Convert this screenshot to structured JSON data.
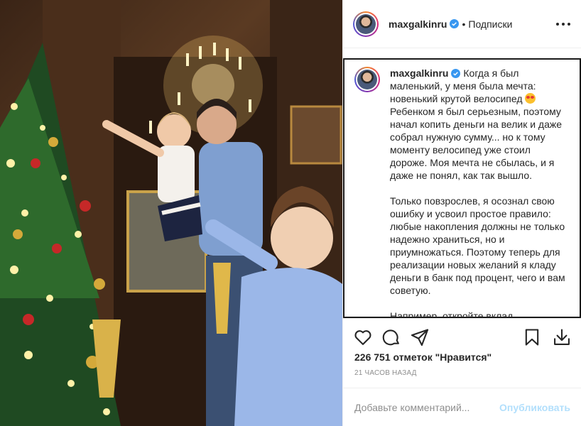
{
  "post": {
    "username": "maxgalkinru",
    "separator": "•",
    "follow_label": "Подписки",
    "caption_paragraphs": [
      "Когда я был маленький, у меня была мечта: новенький крутой велосипед",
      "Ребенком я был серьезным, поэтому начал копить деньги на велик и даже собрал нужную сумму... но к тому моменту велосипед уже стоил дороже. Моя мечта не сбылась, и я даже не понял, как так вышло.",
      "Только повзрослев, я осознал свою ошибку и усвоил простое правило: любые накопления должны не только надежно храниться, но и приумножаться. Поэтому теперь для реализации новых желаний я кладу деньги в банк под процент, чего и вам советую.",
      "Например, откройте вклад"
    ],
    "likes_text": "226 751 отметок \"Нравится\"",
    "time_text": "21 ЧАСОВ НАЗАД"
  },
  "comment": {
    "placeholder": "Добавьте комментарий...",
    "publish_label": "Опубликовать"
  },
  "icons": {
    "like": "heart-icon",
    "comment": "comment-icon",
    "share": "share-icon",
    "save": "bookmark-icon",
    "download": "download-icon",
    "more": "more-icon",
    "verified": "verified-badge-icon"
  },
  "colors": {
    "verified": "#3897f0",
    "publish_disabled": "#b2dffc"
  }
}
